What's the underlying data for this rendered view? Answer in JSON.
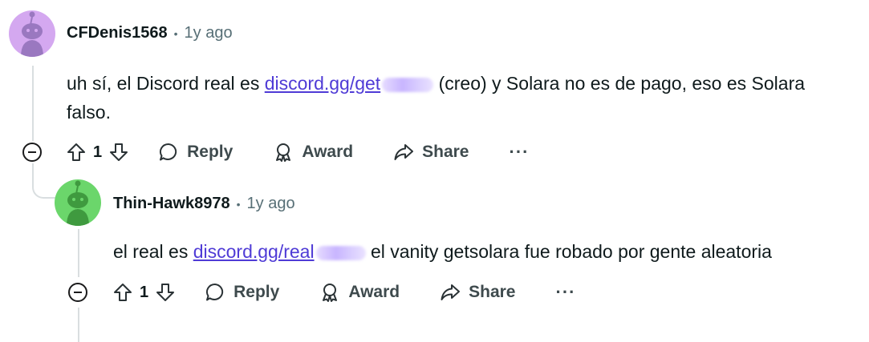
{
  "comments": [
    {
      "author": "CFDenis1568",
      "separator": "•",
      "time": "1y ago",
      "avatar_color": "#d4a8f0",
      "text_before": "uh sí, el Discord real es ",
      "link_text": "discord.gg/get",
      "text_after": " (creo) y Solara no es de pago, eso es Solara",
      "text_line2": "falso.",
      "votes": "1",
      "reply_label": "Reply",
      "award_label": "Award",
      "share_label": "Share",
      "more_label": "···"
    },
    {
      "author": "Thin-Hawk8978",
      "separator": "•",
      "time": "1y ago",
      "avatar_color": "#6bd66b",
      "text_before": "el real es ",
      "link_text": "discord.gg/real",
      "text_after": " el vanity getsolara fue robado por gente aleatoria",
      "votes": "1",
      "reply_label": "Reply",
      "award_label": "Award",
      "share_label": "Share",
      "more_label": "···"
    }
  ]
}
